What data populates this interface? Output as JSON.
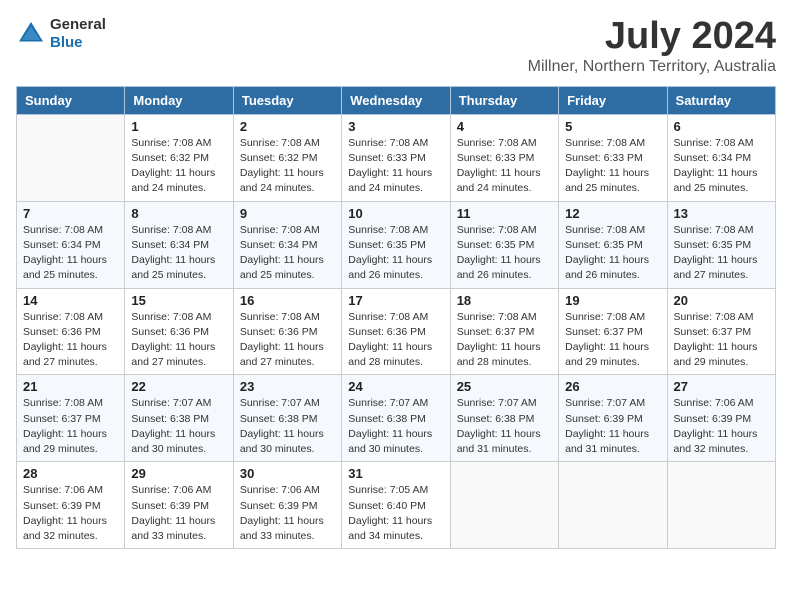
{
  "header": {
    "logo_general": "General",
    "logo_blue": "Blue",
    "month_title": "July 2024",
    "location": "Millner, Northern Territory, Australia"
  },
  "weekdays": [
    "Sunday",
    "Monday",
    "Tuesday",
    "Wednesday",
    "Thursday",
    "Friday",
    "Saturday"
  ],
  "weeks": [
    [
      {
        "day": "",
        "sunrise": "",
        "sunset": "",
        "daylight": ""
      },
      {
        "day": "1",
        "sunrise": "Sunrise: 7:08 AM",
        "sunset": "Sunset: 6:32 PM",
        "daylight": "Daylight: 11 hours and 24 minutes."
      },
      {
        "day": "2",
        "sunrise": "Sunrise: 7:08 AM",
        "sunset": "Sunset: 6:32 PM",
        "daylight": "Daylight: 11 hours and 24 minutes."
      },
      {
        "day": "3",
        "sunrise": "Sunrise: 7:08 AM",
        "sunset": "Sunset: 6:33 PM",
        "daylight": "Daylight: 11 hours and 24 minutes."
      },
      {
        "day": "4",
        "sunrise": "Sunrise: 7:08 AM",
        "sunset": "Sunset: 6:33 PM",
        "daylight": "Daylight: 11 hours and 24 minutes."
      },
      {
        "day": "5",
        "sunrise": "Sunrise: 7:08 AM",
        "sunset": "Sunset: 6:33 PM",
        "daylight": "Daylight: 11 hours and 25 minutes."
      },
      {
        "day": "6",
        "sunrise": "Sunrise: 7:08 AM",
        "sunset": "Sunset: 6:34 PM",
        "daylight": "Daylight: 11 hours and 25 minutes."
      }
    ],
    [
      {
        "day": "7",
        "sunrise": "Sunrise: 7:08 AM",
        "sunset": "Sunset: 6:34 PM",
        "daylight": "Daylight: 11 hours and 25 minutes."
      },
      {
        "day": "8",
        "sunrise": "Sunrise: 7:08 AM",
        "sunset": "Sunset: 6:34 PM",
        "daylight": "Daylight: 11 hours and 25 minutes."
      },
      {
        "day": "9",
        "sunrise": "Sunrise: 7:08 AM",
        "sunset": "Sunset: 6:34 PM",
        "daylight": "Daylight: 11 hours and 25 minutes."
      },
      {
        "day": "10",
        "sunrise": "Sunrise: 7:08 AM",
        "sunset": "Sunset: 6:35 PM",
        "daylight": "Daylight: 11 hours and 26 minutes."
      },
      {
        "day": "11",
        "sunrise": "Sunrise: 7:08 AM",
        "sunset": "Sunset: 6:35 PM",
        "daylight": "Daylight: 11 hours and 26 minutes."
      },
      {
        "day": "12",
        "sunrise": "Sunrise: 7:08 AM",
        "sunset": "Sunset: 6:35 PM",
        "daylight": "Daylight: 11 hours and 26 minutes."
      },
      {
        "day": "13",
        "sunrise": "Sunrise: 7:08 AM",
        "sunset": "Sunset: 6:35 PM",
        "daylight": "Daylight: 11 hours and 27 minutes."
      }
    ],
    [
      {
        "day": "14",
        "sunrise": "Sunrise: 7:08 AM",
        "sunset": "Sunset: 6:36 PM",
        "daylight": "Daylight: 11 hours and 27 minutes."
      },
      {
        "day": "15",
        "sunrise": "Sunrise: 7:08 AM",
        "sunset": "Sunset: 6:36 PM",
        "daylight": "Daylight: 11 hours and 27 minutes."
      },
      {
        "day": "16",
        "sunrise": "Sunrise: 7:08 AM",
        "sunset": "Sunset: 6:36 PM",
        "daylight": "Daylight: 11 hours and 27 minutes."
      },
      {
        "day": "17",
        "sunrise": "Sunrise: 7:08 AM",
        "sunset": "Sunset: 6:36 PM",
        "daylight": "Daylight: 11 hours and 28 minutes."
      },
      {
        "day": "18",
        "sunrise": "Sunrise: 7:08 AM",
        "sunset": "Sunset: 6:37 PM",
        "daylight": "Daylight: 11 hours and 28 minutes."
      },
      {
        "day": "19",
        "sunrise": "Sunrise: 7:08 AM",
        "sunset": "Sunset: 6:37 PM",
        "daylight": "Daylight: 11 hours and 29 minutes."
      },
      {
        "day": "20",
        "sunrise": "Sunrise: 7:08 AM",
        "sunset": "Sunset: 6:37 PM",
        "daylight": "Daylight: 11 hours and 29 minutes."
      }
    ],
    [
      {
        "day": "21",
        "sunrise": "Sunrise: 7:08 AM",
        "sunset": "Sunset: 6:37 PM",
        "daylight": "Daylight: 11 hours and 29 minutes."
      },
      {
        "day": "22",
        "sunrise": "Sunrise: 7:07 AM",
        "sunset": "Sunset: 6:38 PM",
        "daylight": "Daylight: 11 hours and 30 minutes."
      },
      {
        "day": "23",
        "sunrise": "Sunrise: 7:07 AM",
        "sunset": "Sunset: 6:38 PM",
        "daylight": "Daylight: 11 hours and 30 minutes."
      },
      {
        "day": "24",
        "sunrise": "Sunrise: 7:07 AM",
        "sunset": "Sunset: 6:38 PM",
        "daylight": "Daylight: 11 hours and 30 minutes."
      },
      {
        "day": "25",
        "sunrise": "Sunrise: 7:07 AM",
        "sunset": "Sunset: 6:38 PM",
        "daylight": "Daylight: 11 hours and 31 minutes."
      },
      {
        "day": "26",
        "sunrise": "Sunrise: 7:07 AM",
        "sunset": "Sunset: 6:39 PM",
        "daylight": "Daylight: 11 hours and 31 minutes."
      },
      {
        "day": "27",
        "sunrise": "Sunrise: 7:06 AM",
        "sunset": "Sunset: 6:39 PM",
        "daylight": "Daylight: 11 hours and 32 minutes."
      }
    ],
    [
      {
        "day": "28",
        "sunrise": "Sunrise: 7:06 AM",
        "sunset": "Sunset: 6:39 PM",
        "daylight": "Daylight: 11 hours and 32 minutes."
      },
      {
        "day": "29",
        "sunrise": "Sunrise: 7:06 AM",
        "sunset": "Sunset: 6:39 PM",
        "daylight": "Daylight: 11 hours and 33 minutes."
      },
      {
        "day": "30",
        "sunrise": "Sunrise: 7:06 AM",
        "sunset": "Sunset: 6:39 PM",
        "daylight": "Daylight: 11 hours and 33 minutes."
      },
      {
        "day": "31",
        "sunrise": "Sunrise: 7:05 AM",
        "sunset": "Sunset: 6:40 PM",
        "daylight": "Daylight: 11 hours and 34 minutes."
      },
      {
        "day": "",
        "sunrise": "",
        "sunset": "",
        "daylight": ""
      },
      {
        "day": "",
        "sunrise": "",
        "sunset": "",
        "daylight": ""
      },
      {
        "day": "",
        "sunrise": "",
        "sunset": "",
        "daylight": ""
      }
    ]
  ]
}
